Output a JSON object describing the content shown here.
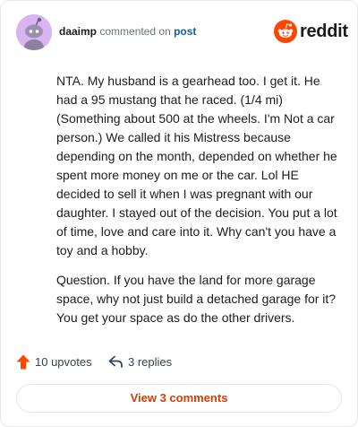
{
  "comment": {
    "username": "daaimp",
    "action_text": "commented on",
    "post_link": "post",
    "paragraphs": [
      "NTA. My husband is a gearhead too. I get it. He had a 95 mustang that he raced. (1/4 mi) (Something about 500 at the wheels. I'm Not a car person.) We called it his Mistress because depending on the month, depended on whether he spent more money on me or the car. Lol HE decided to sell it when I was pregnant with our daughter. I stayed out of the decision. You put a lot of time, love and care into it. Why can't you have a toy and a hobby.",
      "Question. If you have the land for more garage space, why not just build a detached garage for it? You get your space as do the other drivers."
    ]
  },
  "brand": {
    "wordmark": "reddit",
    "icon": "reddit-snoo-icon",
    "color": "#ff4500"
  },
  "actions": {
    "upvotes_label": "10 upvotes",
    "replies_label": "3 replies",
    "upvote_icon": "upvote-arrow-icon",
    "reply_icon": "reply-icon",
    "upvote_color": "#ff4500"
  },
  "footer": {
    "view_comments_label": "View 3 comments",
    "accent": "#d93a00"
  },
  "avatar": {
    "icon": "snoo-avatar-icon",
    "background": "#d8b4f0"
  }
}
